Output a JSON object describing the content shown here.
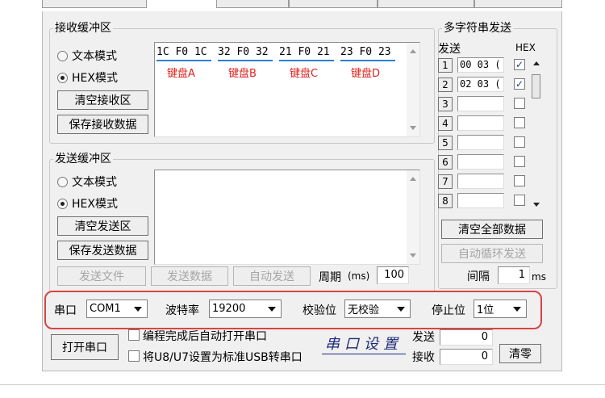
{
  "receive_group": {
    "title": "接收缓冲区",
    "mode_text": "文本模式",
    "mode_hex": "HEX模式",
    "clear_button": "清空接收区",
    "save_button": "保存接收数据",
    "hex_groups": [
      {
        "bytes": "1C F0 1C",
        "label": "键盘A"
      },
      {
        "bytes": "32 F0 32",
        "label": "键盘B"
      },
      {
        "bytes": "21 F0 21",
        "label": "键盘C"
      },
      {
        "bytes": "23 F0 23",
        "label": "键盘D"
      }
    ]
  },
  "send_group": {
    "title": "发送缓冲区",
    "mode_text": "文本模式",
    "mode_hex": "HEX模式",
    "clear_button": "清空发送区",
    "save_button": "保存发送数据",
    "send_file_button": "发送文件",
    "send_data_button": "发送数据",
    "auto_send_button": "自动发送",
    "period_label": "周期",
    "period_unit": "(ms)",
    "period_value": "100"
  },
  "multi_string": {
    "title": "多字符串发送",
    "col_send": "发送",
    "col_hex": "HEX",
    "rows": [
      {
        "num": "1",
        "value": "00 03 (",
        "hex": true
      },
      {
        "num": "2",
        "value": "02 03 (",
        "hex": true
      },
      {
        "num": "3",
        "value": "",
        "hex": false
      },
      {
        "num": "4",
        "value": "",
        "hex": false
      },
      {
        "num": "5",
        "value": "",
        "hex": false
      },
      {
        "num": "6",
        "value": "",
        "hex": false
      },
      {
        "num": "7",
        "value": "",
        "hex": false
      },
      {
        "num": "8",
        "value": "",
        "hex": false
      }
    ],
    "clear_all_button": "清空全部数据",
    "auto_loop_button": "自动循环发送",
    "interval_label": "间隔",
    "interval_value": "1",
    "interval_unit": "ms"
  },
  "serial_settings": {
    "port_label": "串口",
    "port_value": "COM1",
    "baud_label": "波特率",
    "baud_value": "19200",
    "parity_label": "校验位",
    "parity_value": "无校验",
    "stop_label": "停止位",
    "stop_value": "1位"
  },
  "bottom": {
    "open_port_button": "打开串口",
    "auto_open_label": "编程完成后自动打开串口",
    "usb_label": "将U8/U7设置为标准USB转串口",
    "annotation": "串口设置",
    "send_count_label": "发送",
    "send_count_value": "0",
    "recv_count_label": "接收",
    "recv_count_value": "0",
    "clear_button": "清零"
  },
  "colors": {
    "highlight_border": "#d94444",
    "label_red": "#e0201c",
    "underline_blue": "#2a7fd4",
    "annotation_ink": "#1d2a7a"
  }
}
